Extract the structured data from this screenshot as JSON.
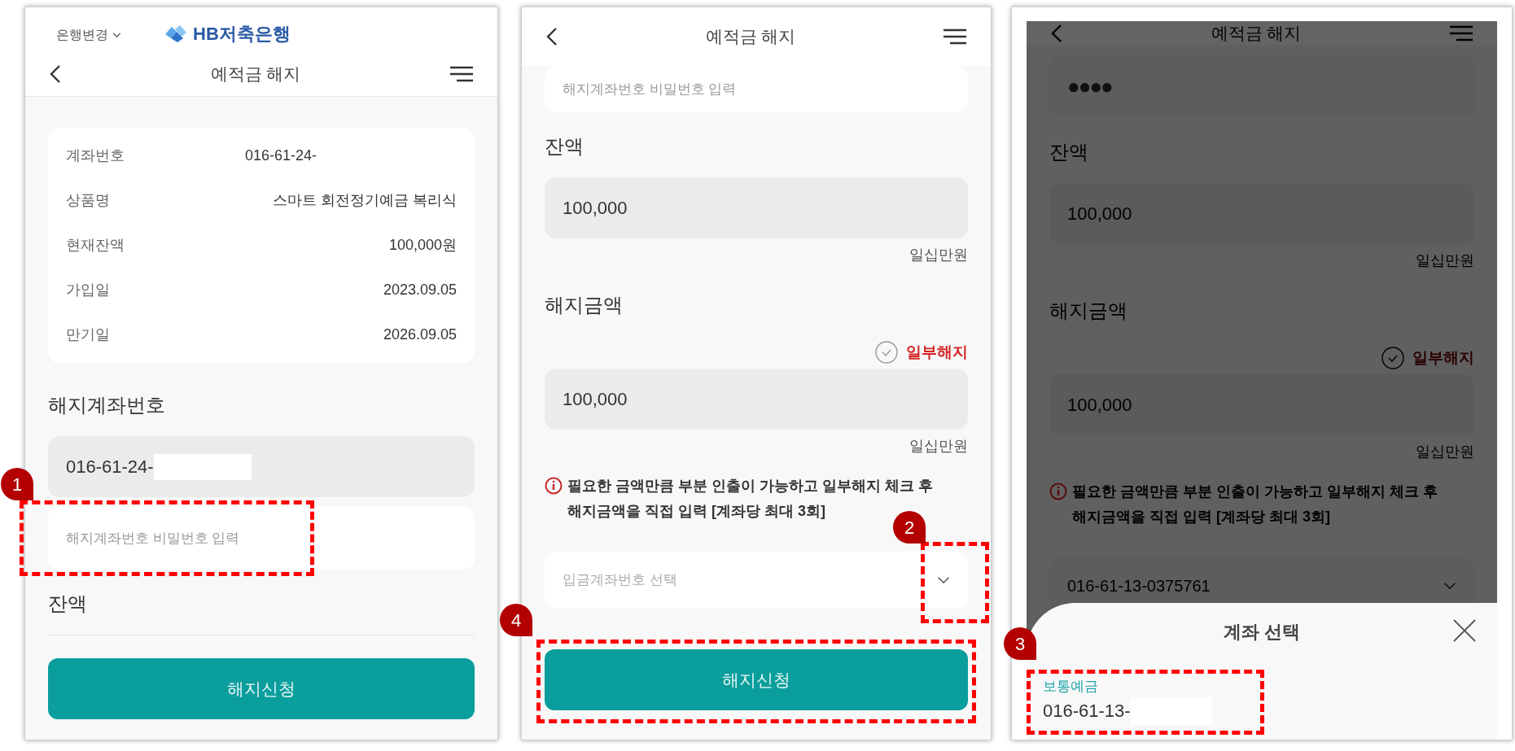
{
  "panels": [
    {
      "dimmed": false,
      "top_bar": {
        "bank_switch": "은행변경",
        "logo": "HB저축은행"
      },
      "title": "예적금 해지",
      "blocks": [
        {
          "kind": "info_card",
          "rows": [
            {
              "label": "계좌번호",
              "value": "016-61-24-"
            },
            {
              "label": "상품명",
              "value": "스마트 회전정기예금 복리식"
            },
            {
              "label": "현재잔액",
              "value": "100,000원"
            },
            {
              "label": "가입일",
              "value": "2023.09.05"
            },
            {
              "label": "만기일",
              "value": "2026.09.05"
            }
          ]
        },
        {
          "kind": "label",
          "text": "해지계좌번호"
        },
        {
          "kind": "readonly_field",
          "value": "016-61-24-",
          "redacted": true
        },
        {
          "kind": "password_field",
          "placeholder": "해지계좌번호 비밀번호 입력",
          "annotation": "1"
        },
        {
          "kind": "label",
          "text": "잔액"
        },
        {
          "kind": "divider"
        },
        {
          "kind": "button",
          "label": "해지신청"
        }
      ]
    },
    {
      "dimmed": false,
      "title": "예적금 해지",
      "blocks": [
        {
          "kind": "password_field",
          "placeholder": "해지계좌번호 비밀번호 입력"
        },
        {
          "kind": "label",
          "text": "잔액"
        },
        {
          "kind": "readonly_field",
          "value": "100,000",
          "redacted": false
        },
        {
          "kind": "caption",
          "text": "일십만원"
        },
        {
          "kind": "label",
          "text": "해지금액"
        },
        {
          "kind": "check_option",
          "label": "일부해지",
          "checked": false
        },
        {
          "kind": "readonly_field",
          "value": "100,000",
          "redacted": false
        },
        {
          "kind": "caption",
          "text": "일십만원"
        },
        {
          "kind": "notice",
          "text": "필요한 금액만큼 부분 인출이 가능하고 일부해지 체크 후 해지금액을 직접 입력 [계좌당 최대 3회]"
        },
        {
          "kind": "select",
          "placeholder": "입금계좌번호 선택",
          "annotation": "2"
        },
        {
          "kind": "button",
          "label": "해지신청",
          "annotation": "4"
        }
      ]
    },
    {
      "dimmed": true,
      "title": "예적금 해지",
      "blocks": [
        {
          "kind": "password_field",
          "value": "●●●●"
        },
        {
          "kind": "label",
          "text": "잔액"
        },
        {
          "kind": "readonly_field",
          "value": "100,000",
          "redacted": false
        },
        {
          "kind": "caption",
          "text": "일십만원"
        },
        {
          "kind": "label",
          "text": "해지금액"
        },
        {
          "kind": "check_option",
          "label": "일부해지",
          "checked": false
        },
        {
          "kind": "readonly_field",
          "value": "100,000",
          "redacted": false
        },
        {
          "kind": "caption",
          "text": "일십만원"
        },
        {
          "kind": "notice",
          "text": "필요한 금액만큼 부분 인출이 가능하고 일부해지 체크 후 해지금액을 직접 입력 [계좌당 최대 3회]"
        },
        {
          "kind": "select",
          "value": "016-61-13-0375761"
        }
      ],
      "sheet": {
        "title": "계좌 선택",
        "items": [
          {
            "type": "보통예금",
            "number": "016-61-13-",
            "redacted": true,
            "annotation": "3"
          }
        ]
      }
    }
  ]
}
